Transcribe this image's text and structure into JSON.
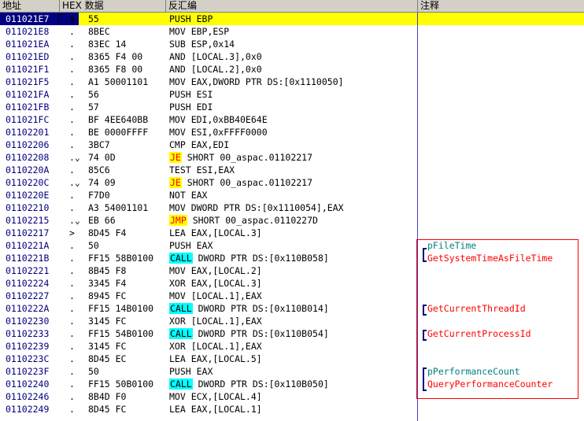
{
  "header": {
    "addr": "地址",
    "hex": "HEX 数据",
    "disasm": "反汇编",
    "comment": "注释"
  },
  "colors": {
    "address": "#000080",
    "selected_row": "#ffff00",
    "call_highlight": "#00ffff",
    "jump_text": "#ff0000",
    "comment_api": "#ff0000",
    "comment_param": "#008080"
  },
  "rows": [
    {
      "addr": "011021E7",
      "mark": "$",
      "hex": "55",
      "kw": "",
      "instr": "PUSH EBP",
      "comment": "",
      "selected": true
    },
    {
      "addr": "011021E8",
      "mark": ".",
      "hex": "8BEC",
      "kw": "",
      "instr": "MOV EBP,ESP",
      "comment": ""
    },
    {
      "addr": "011021EA",
      "mark": ".",
      "hex": "83EC 14",
      "kw": "",
      "instr": "SUB ESP,0x14",
      "comment": ""
    },
    {
      "addr": "011021ED",
      "mark": ".",
      "hex": "8365 F4 00",
      "kw": "",
      "instr": "AND [LOCAL.3],0x0",
      "comment": ""
    },
    {
      "addr": "011021F1",
      "mark": ".",
      "hex": "8365 F8 00",
      "kw": "",
      "instr": "AND [LOCAL.2],0x0",
      "comment": ""
    },
    {
      "addr": "011021F5",
      "mark": ".",
      "hex": "A1 50001101",
      "kw": "",
      "instr": "MOV EAX,DWORD PTR DS:[0x1110050]",
      "comment": ""
    },
    {
      "addr": "011021FA",
      "mark": ".",
      "hex": "56",
      "kw": "",
      "instr": "PUSH ESI",
      "comment": ""
    },
    {
      "addr": "011021FB",
      "mark": ".",
      "hex": "57",
      "kw": "",
      "instr": "PUSH EDI",
      "comment": ""
    },
    {
      "addr": "011021FC",
      "mark": ".",
      "hex": "BF 4EE640BB",
      "kw": "",
      "instr": "MOV EDI,0xBB40E64E",
      "comment": ""
    },
    {
      "addr": "01102201",
      "mark": ".",
      "hex": "BE 0000FFFF",
      "kw": "",
      "instr": "MOV ESI,0xFFFF0000",
      "comment": ""
    },
    {
      "addr": "01102206",
      "mark": ".",
      "hex": "3BC7",
      "kw": "",
      "instr": "CMP EAX,EDI",
      "comment": ""
    },
    {
      "addr": "01102208",
      "mark": ".⌄",
      "hex": "74 0D",
      "kw": "JE",
      "kwtype": "jmp",
      "instr": " SHORT 00_aspac.01102217",
      "comment": ""
    },
    {
      "addr": "0110220A",
      "mark": ".",
      "hex": "85C6",
      "kw": "",
      "instr": "TEST ESI,EAX",
      "comment": ""
    },
    {
      "addr": "0110220C",
      "mark": ".⌄",
      "hex": "74 09",
      "kw": "JE",
      "kwtype": "jmp",
      "instr": " SHORT 00_aspac.01102217",
      "comment": ""
    },
    {
      "addr": "0110220E",
      "mark": ".",
      "hex": "F7D0",
      "kw": "",
      "instr": "NOT EAX",
      "comment": ""
    },
    {
      "addr": "01102210",
      "mark": ".",
      "hex": "A3 54001101",
      "kw": "",
      "instr": "MOV DWORD PTR DS:[0x1110054],EAX",
      "comment": ""
    },
    {
      "addr": "01102215",
      "mark": ".⌄",
      "hex": "EB 66",
      "kw": "JMP",
      "kwtype": "jmp",
      "instr": " SHORT 00_aspac.0110227D",
      "comment": ""
    },
    {
      "addr": "01102217",
      "mark": ">",
      "hex": "8D45 F4",
      "kw": "",
      "instr": "LEA EAX,[LOCAL.3]",
      "comment": ""
    },
    {
      "addr": "0110221A",
      "mark": ".",
      "hex": "50",
      "kw": "",
      "instr": "PUSH EAX",
      "comment": "pFileTime",
      "ctype": "param"
    },
    {
      "addr": "0110221B",
      "mark": ".",
      "hex": "FF15 58B0100",
      "kw": "CALL",
      "kwtype": "call",
      "instr": " DWORD PTR DS:[0x110B058]",
      "comment": "GetSystemTimeAsFileTime",
      "ctype": "api"
    },
    {
      "addr": "01102221",
      "mark": ".",
      "hex": "8B45 F8",
      "kw": "",
      "instr": "MOV EAX,[LOCAL.2]",
      "comment": ""
    },
    {
      "addr": "01102224",
      "mark": ".",
      "hex": "3345 F4",
      "kw": "",
      "instr": "XOR EAX,[LOCAL.3]",
      "comment": ""
    },
    {
      "addr": "01102227",
      "mark": ".",
      "hex": "8945 FC",
      "kw": "",
      "instr": "MOV [LOCAL.1],EAX",
      "comment": ""
    },
    {
      "addr": "0110222A",
      "mark": ".",
      "hex": "FF15 14B0100",
      "kw": "CALL",
      "kwtype": "call",
      "instr": " DWORD PTR DS:[0x110B014]",
      "comment": "GetCurrentThreadId",
      "ctype": "api"
    },
    {
      "addr": "01102230",
      "mark": ".",
      "hex": "3145 FC",
      "kw": "",
      "instr": "XOR [LOCAL.1],EAX",
      "comment": ""
    },
    {
      "addr": "01102233",
      "mark": ".",
      "hex": "FF15 54B0100",
      "kw": "CALL",
      "kwtype": "call",
      "instr": " DWORD PTR DS:[0x110B054]",
      "comment": "GetCurrentProcessId",
      "ctype": "api"
    },
    {
      "addr": "01102239",
      "mark": ".",
      "hex": "3145 FC",
      "kw": "",
      "instr": "XOR [LOCAL.1],EAX",
      "comment": ""
    },
    {
      "addr": "0110223C",
      "mark": ".",
      "hex": "8D45 EC",
      "kw": "",
      "instr": "LEA EAX,[LOCAL.5]",
      "comment": ""
    },
    {
      "addr": "0110223F",
      "mark": ".",
      "hex": "50",
      "kw": "",
      "instr": "PUSH EAX",
      "comment": "pPerformanceCount",
      "ctype": "param"
    },
    {
      "addr": "01102240",
      "mark": ".",
      "hex": "FF15 50B0100",
      "kw": "CALL",
      "kwtype": "call",
      "instr": " DWORD PTR DS:[0x110B050]",
      "comment": "QueryPerformanceCounter",
      "ctype": "api"
    },
    {
      "addr": "01102246",
      "mark": ".",
      "hex": "8B4D F0",
      "kw": "",
      "instr": "MOV ECX,[LOCAL.4]",
      "comment": ""
    },
    {
      "addr": "01102249",
      "mark": ".",
      "hex": "8D45 FC",
      "kw": "",
      "instr": "LEA EAX,[LOCAL.1]",
      "comment": ""
    }
  ]
}
